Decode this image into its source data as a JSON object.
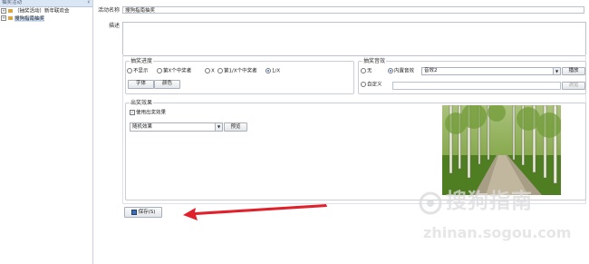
{
  "left_panel": {
    "header": "抽奖活动",
    "pin_icon": "pin-icon",
    "tree": [
      {
        "label": "（抽奖活动）新年联欢会",
        "expander": "+"
      },
      {
        "label": "搜狗指南抽奖",
        "expander": "+"
      }
    ]
  },
  "form": {
    "activity_name_label": "活动名称",
    "activity_name_value": "搜狗指南抽奖",
    "description_label": "描述",
    "description_value": ""
  },
  "draw_progress": {
    "title": "抽奖进度",
    "options": [
      "不显示",
      "第X个中奖者",
      "X",
      "第1/X个中奖者",
      "1/X"
    ],
    "selected": "1/X",
    "font_button": "字体",
    "color_button": "颜色"
  },
  "draw_sound": {
    "title": "抽奖音效",
    "none_label": "无",
    "builtin_label": "内置音效",
    "builtin_value": "音效2",
    "play_button": "播放",
    "custom_label": "自定义",
    "custom_value": "",
    "browse_button": "浏览"
  },
  "exit_effect": {
    "title": "出奖效果",
    "use_label": "使用出奖效果",
    "use_checked": true,
    "effect_value": "随机效果",
    "preview_button": "预览"
  },
  "save_button": "保存(S)",
  "watermark": {
    "brand": "搜狗指南",
    "url": "zhinan.sogou.com"
  },
  "colors": {
    "arrow": "#e0202a",
    "panel_border": "#c7d3e3",
    "selected_radio": "#2d6fd6"
  }
}
